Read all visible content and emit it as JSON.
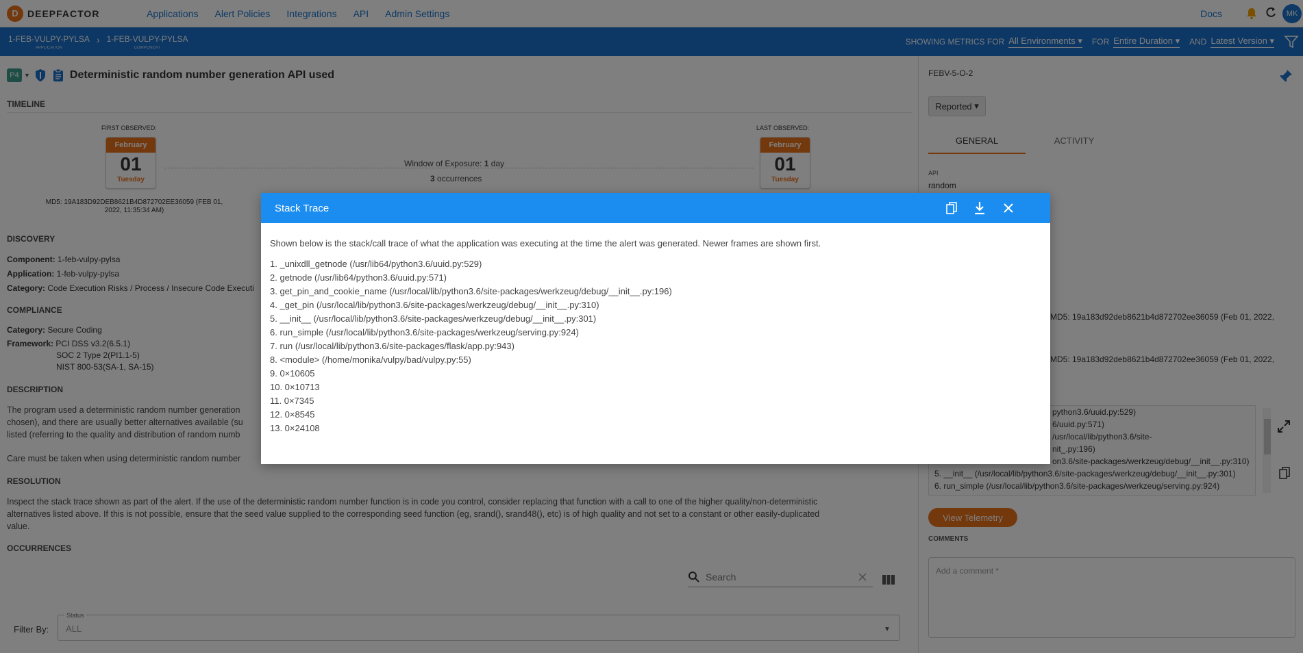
{
  "brand": {
    "name": "DEEPFACTOR"
  },
  "nav": {
    "items": [
      "Applications",
      "Alert Policies",
      "Integrations",
      "API",
      "Admin Settings"
    ],
    "docs": "Docs",
    "avatar_initials": "MK"
  },
  "breadcrumb": {
    "app": "1-FEB-VULPY-PYLSA",
    "app_sub": "APPLICATION",
    "component": "1-FEB-VULPY-PYLSA",
    "component_sub": "COMPONENT"
  },
  "metrics": {
    "showing_label": "SHOWING METRICS FOR",
    "env": "All Environments",
    "for_label": "FOR",
    "duration": "Entire Duration",
    "and_label": "AND",
    "version": "Latest Version"
  },
  "alert": {
    "priority": "P4",
    "title": "Deterministic random number generation API used"
  },
  "timeline": {
    "heading": "TIMELINE",
    "first_label": "FIRST OBSERVED:",
    "first_month": "February",
    "first_day": "01",
    "first_weekday": "Tuesday",
    "last_label": "LAST OBSERVED:",
    "last_month": "February",
    "last_day": "01",
    "last_weekday": "Tuesday",
    "window_label": "Window of Exposure:",
    "window_value": "1",
    "window_unit": "day",
    "occ_count": "3",
    "occ_label": "occurrences",
    "md5": "MD5: 19A183D92DEB8621B4D872702EE36059 (FEB 01, 2022, 11:35:34 AM)"
  },
  "discovery": {
    "heading": "DISCOVERY",
    "component_label": "Component:",
    "component": "1-feb-vulpy-pylsa",
    "application_label": "Application:",
    "application": "1-feb-vulpy-pylsa",
    "category_label": "Category:",
    "category": "Code Execution Risks / Process / Insecure Code Executi"
  },
  "compliance": {
    "heading": "COMPLIANCE",
    "category_label": "Category:",
    "category": "Secure Coding",
    "framework_label": "Framework:",
    "frameworks": [
      "PCI DSS v3.2(6.5.1)",
      "SOC 2 Type 2(PI1.1-5)",
      "NIST 800-53(SA-1, SA-15)"
    ]
  },
  "description": {
    "heading": "DESCRIPTION",
    "line1": "The program used a deterministic random number generation",
    "line2": "chosen), and there are usually better alternatives available (su",
    "line3": "listed (referring to the quality and distribution of random numb",
    "line4": "Care must be taken when using deterministic random number"
  },
  "resolution": {
    "heading": "RESOLUTION",
    "line1": "Inspect the stack trace shown as part of the alert. If the use of the deterministic random number function is in code you control, consider replacing that function with a call to one of the higher quality/non-deterministic",
    "line2": "alternatives listed above. If this is not possible, ensure that the seed value supplied to the corresponding seed function (eg, srand(), srand48(), etc) is of high quality and not set to a constant or other easily-duplicated",
    "line3": "value."
  },
  "occurrences": {
    "heading": "OCCURRENCES",
    "search_placeholder": "Search",
    "filter_by": "Filter By:",
    "status_label": "Status",
    "status_value": "ALL"
  },
  "side": {
    "id": "FEBV-5-O-2",
    "status": "Reported",
    "tabs": [
      "GENERAL",
      "ACTIVITY"
    ],
    "api_label": "API",
    "api_value": "random",
    "md5_1": "MD5: 19a183d92deb8621b4d872702ee36059 (Feb 01, 2022,",
    "md5_2": "MD5: 19a183d92deb8621b4d872702ee36059 (Feb 01, 2022,",
    "trace_lines": [
      "python3.6/uuid.py:529)",
      "6/uuid.py:571)",
      "/usr/local/lib/python3.6/site-",
      "nit_.py:196)",
      "on3.6/site-packages/werkzeug/debug/__init__.py:310)",
      "5. __init__ (/usr/local/lib/python3.6/site-packages/werkzeug/debug/__init__.py:301)",
      "6. run_simple (/usr/local/lib/python3.6/site-packages/werkzeug/serving.py:924)"
    ],
    "telemetry_button": "View Telemetry",
    "comments_label": "COMMENTS",
    "comment_placeholder": "Add a comment *"
  },
  "modal": {
    "title": "Stack Trace",
    "description": "Shown below is the stack/call trace of what the application was executing at the time the alert was generated. Newer frames are shown first.",
    "frames": [
      "1. _unixdll_getnode (/usr/lib64/python3.6/uuid.py:529)",
      "2. getnode (/usr/lib64/python3.6/uuid.py:571)",
      "3. get_pin_and_cookie_name (/usr/local/lib/python3.6/site-packages/werkzeug/debug/__init__.py:196)",
      "4. _get_pin (/usr/local/lib/python3.6/site-packages/werkzeug/debug/__init__.py:310)",
      "5. __init__ (/usr/local/lib/python3.6/site-packages/werkzeug/debug/__init__.py:301)",
      "6. run_simple (/usr/local/lib/python3.6/site-packages/werkzeug/serving.py:924)",
      "7. run (/usr/local/lib/python3.6/site-packages/flask/app.py:943)",
      "8. <module> (/home/monika/vulpy/bad/vulpy.py:55)",
      "9. 0×10605",
      "10. 0×10713",
      "11. 0×7345",
      "12. 0×8545",
      "13. 0×24108"
    ]
  },
  "colors": {
    "accent": "#1b6fc8",
    "modal_header": "#1b8cf0",
    "brand_orange": "#e8701a"
  }
}
